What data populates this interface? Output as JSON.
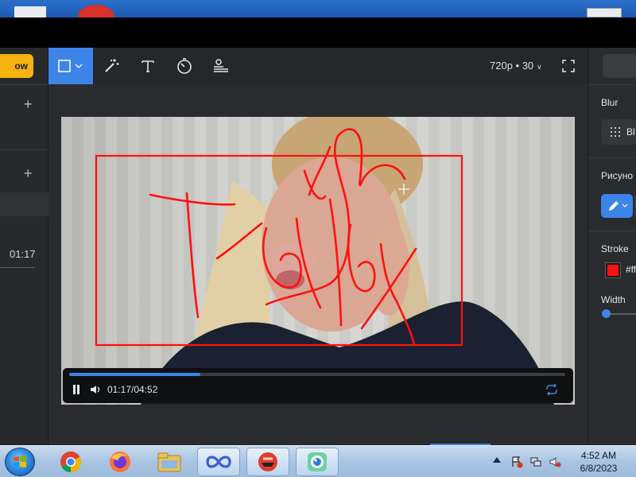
{
  "window": {
    "primary_button_label": "ow"
  },
  "left_panel": {
    "current_time": "01:17"
  },
  "toolbar": {
    "tools": [
      {
        "name": "rectangle-select",
        "active": true
      },
      {
        "name": "magic-wand",
        "active": false
      },
      {
        "name": "text",
        "active": false
      },
      {
        "name": "speed",
        "active": false
      },
      {
        "name": "adjust",
        "active": false
      }
    ],
    "quality_label": "720p • 30",
    "fullscreen_icon": "fullscreen-icon"
  },
  "video": {
    "annotation_color": "#ff1010",
    "time_display": "01:17/04:52",
    "progress": 0.265
  },
  "right_panel": {
    "blur_section_title": "Blur",
    "blur_option_label": "Bl",
    "drawing_section_title": "Рисуно",
    "stroke_label": "Stroke",
    "stroke_color": "#ff1010",
    "stroke_hex_text": "#ff",
    "width_label": "Width",
    "width_value": 0
  },
  "taskbar": {
    "apps": [
      "chrome",
      "firefox",
      "file-explorer",
      "infinity-app",
      "bandwidth-app",
      "screen-recorder"
    ],
    "time": "4:52 AM",
    "date": "6/8/2023"
  },
  "colors": {
    "accent": "#3d84e8",
    "warning": "#f5b30f",
    "annotation": "#ff1010"
  }
}
